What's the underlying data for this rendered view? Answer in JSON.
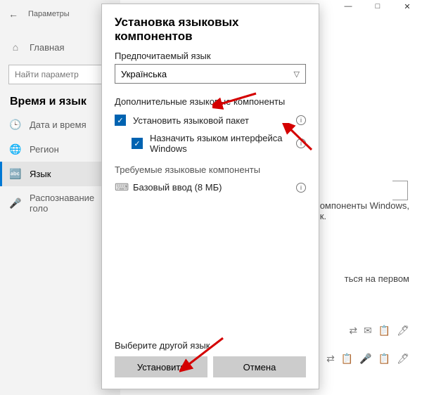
{
  "titlebar": {
    "min": "—",
    "max": "□",
    "close": "✕"
  },
  "bg": {
    "header_back": "←",
    "header_title": "Параметры",
    "home_icon": "⌂",
    "home_label": "Главная",
    "search_placeholder": "Найти параметр",
    "section_title": "Время и язык",
    "nav": [
      {
        "icon": "🕒",
        "label": "Дата и время"
      },
      {
        "icon": "🌐",
        "label": "Регион"
      },
      {
        "icon": "🔤",
        "label": "Язык"
      },
      {
        "icon": "🎤",
        "label": "Распознавание голо"
      }
    ],
    "right_snippet1a": "омпоненты Windows,",
    "right_snippet1b": "к.",
    "right_snippet2": "ться на первом"
  },
  "modal": {
    "title": "Установка языковых компонентов",
    "pref_label": "Предпочитаемый язык",
    "combo_value": "Українська",
    "opt_head": "Дополнительные языковые компоненты",
    "opt1": "Установить языковой пакет",
    "opt2": "Назначить языком интерфейса Windows",
    "req_head": "Требуемые языковые компоненты",
    "req1_icon": "⌨",
    "req1": "Базовый ввод (8 МБ)",
    "footer_label": "Выберите другой язык",
    "install": "Установить",
    "cancel": "Отмена"
  },
  "iconrow": {
    "a": "⇄",
    "b": "✉",
    "c": "📋",
    "d": "🖊",
    "e": "🎤"
  }
}
